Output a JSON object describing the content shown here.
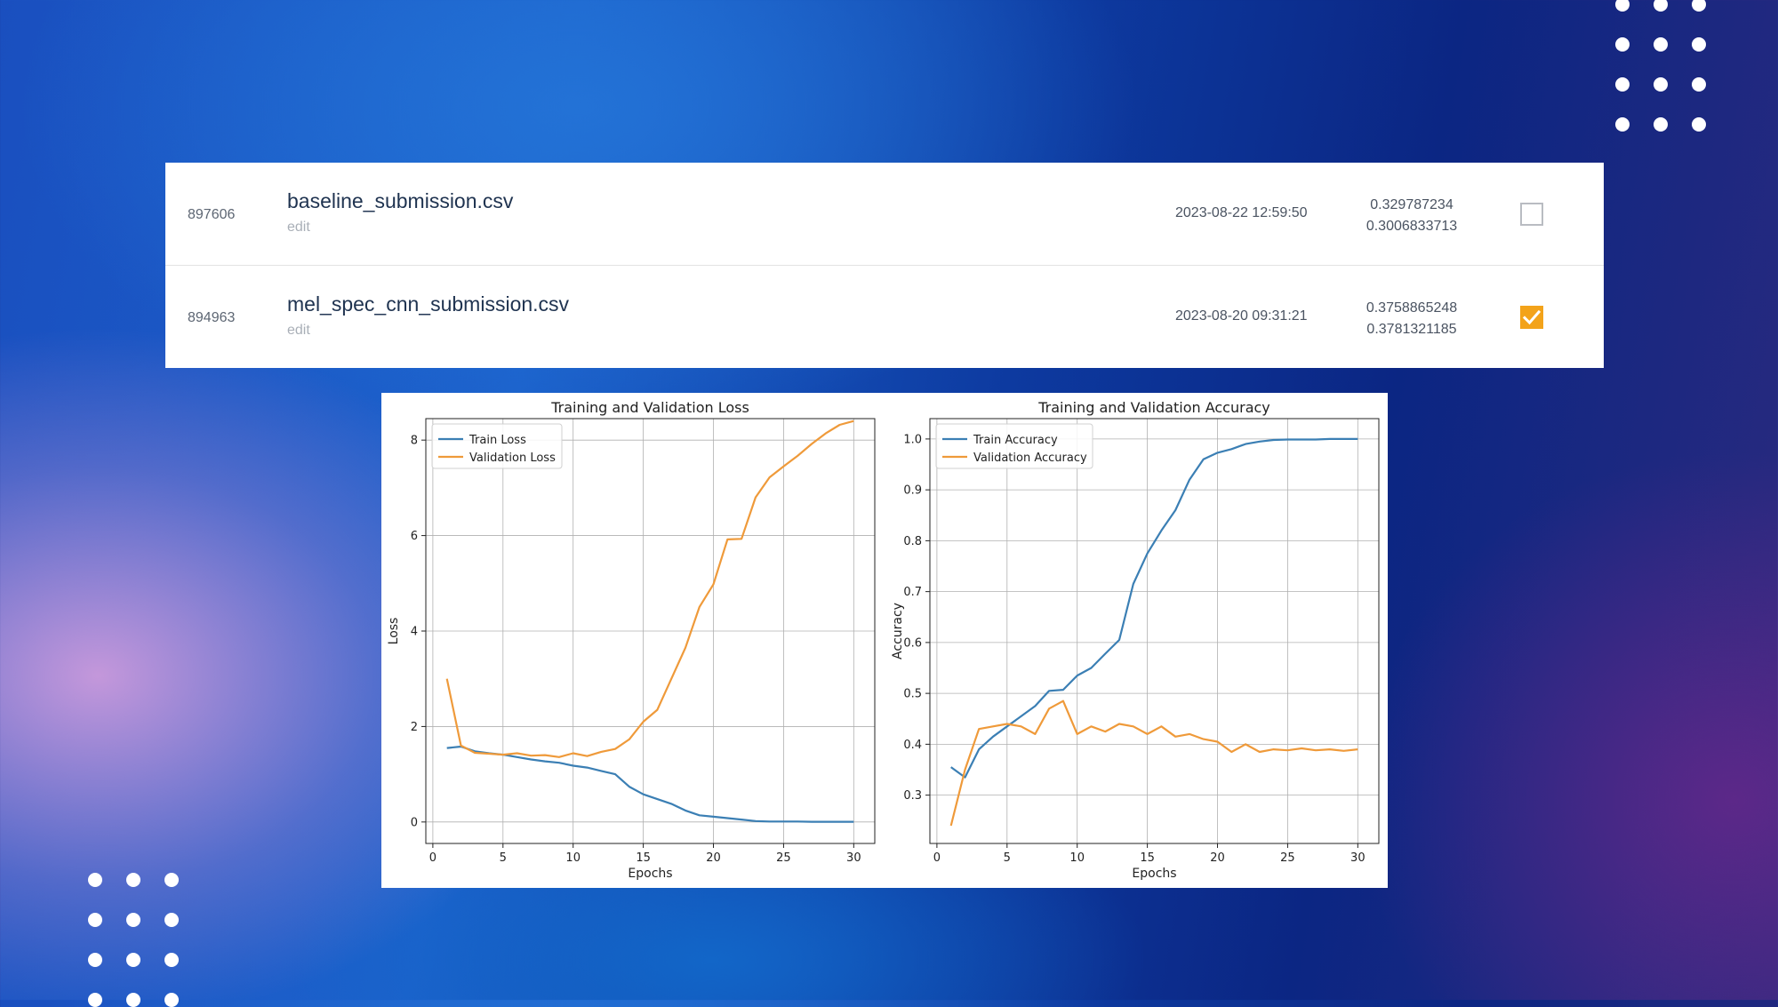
{
  "submissions": [
    {
      "id": "897606",
      "filename": "baseline_submission.csv",
      "edit_label": "edit",
      "date": "2023-08-22 12:59:50",
      "public_score": "0.329787234",
      "private_score": "0.3006833713",
      "selected": false
    },
    {
      "id": "894963",
      "filename": "mel_spec_cnn_submission.csv",
      "edit_label": "edit",
      "date": "2023-08-20 09:31:21",
      "public_score": "0.3758865248",
      "private_score": "0.3781321185",
      "selected": true
    }
  ],
  "colors": {
    "checkbox_checked": "#f3a31a",
    "train_line": "#3b7fb4",
    "validation_line": "#ef9a3a"
  },
  "chart_data": [
    {
      "type": "line",
      "title": "Training and Validation Loss",
      "xlabel": "Epochs",
      "ylabel": "Loss",
      "xlim": [
        -0.5,
        31.5
      ],
      "ylim": [
        -0.45,
        8.45
      ],
      "xticks": [
        0,
        5,
        10,
        15,
        20,
        25,
        30
      ],
      "yticks": [
        0,
        2,
        4,
        6,
        8
      ],
      "grid": true,
      "legend": "top-left",
      "x": [
        1,
        2,
        3,
        4,
        5,
        6,
        7,
        8,
        9,
        10,
        11,
        12,
        13,
        14,
        15,
        16,
        17,
        18,
        19,
        20,
        21,
        22,
        23,
        24,
        25,
        26,
        27,
        28,
        29,
        30
      ],
      "series": [
        {
          "name": "Train Loss",
          "color": "#3b7fb4",
          "values": [
            1.55,
            1.58,
            1.48,
            1.44,
            1.41,
            1.36,
            1.31,
            1.27,
            1.24,
            1.18,
            1.14,
            1.07,
            1.0,
            0.74,
            0.58,
            0.48,
            0.38,
            0.24,
            0.14,
            0.11,
            0.08,
            0.05,
            0.02,
            0.01,
            0.01,
            0.01,
            0.005,
            0.005,
            0.005,
            0.005
          ]
        },
        {
          "name": "Validation Loss",
          "color": "#ef9a3a",
          "values": [
            3.0,
            1.6,
            1.45,
            1.43,
            1.41,
            1.44,
            1.39,
            1.4,
            1.36,
            1.44,
            1.38,
            1.47,
            1.53,
            1.73,
            2.1,
            2.35,
            3.0,
            3.65,
            4.5,
            4.98,
            5.92,
            5.93,
            6.8,
            7.22,
            7.45,
            7.67,
            7.92,
            8.14,
            8.32,
            8.4
          ]
        }
      ]
    },
    {
      "type": "line",
      "title": "Training and Validation Accuracy",
      "xlabel": "Epochs",
      "ylabel": "Accuracy",
      "xlim": [
        -0.5,
        31.5
      ],
      "ylim": [
        0.205,
        1.04
      ],
      "xticks": [
        0,
        5,
        10,
        15,
        20,
        25,
        30
      ],
      "yticks": [
        0.3,
        0.4,
        0.5,
        0.6,
        0.7,
        0.8,
        0.9,
        1.0
      ],
      "grid": true,
      "legend": "top-left",
      "x": [
        1,
        2,
        3,
        4,
        5,
        6,
        7,
        8,
        9,
        10,
        11,
        12,
        13,
        14,
        15,
        16,
        17,
        18,
        19,
        20,
        21,
        22,
        23,
        24,
        25,
        26,
        27,
        28,
        29,
        30
      ],
      "series": [
        {
          "name": "Train Accuracy",
          "color": "#3b7fb4",
          "values": [
            0.355,
            0.335,
            0.39,
            0.415,
            0.435,
            0.455,
            0.475,
            0.505,
            0.507,
            0.535,
            0.55,
            0.578,
            0.605,
            0.715,
            0.775,
            0.82,
            0.86,
            0.92,
            0.96,
            0.973,
            0.98,
            0.99,
            0.995,
            0.998,
            0.999,
            0.999,
            0.999,
            1.0,
            1.0,
            1.0
          ]
        },
        {
          "name": "Validation Accuracy",
          "color": "#ef9a3a",
          "values": [
            0.24,
            0.35,
            0.43,
            0.435,
            0.44,
            0.435,
            0.42,
            0.47,
            0.485,
            0.42,
            0.435,
            0.425,
            0.44,
            0.435,
            0.42,
            0.435,
            0.415,
            0.42,
            0.41,
            0.405,
            0.385,
            0.4,
            0.385,
            0.39,
            0.388,
            0.392,
            0.388,
            0.39,
            0.387,
            0.39
          ]
        }
      ]
    }
  ]
}
